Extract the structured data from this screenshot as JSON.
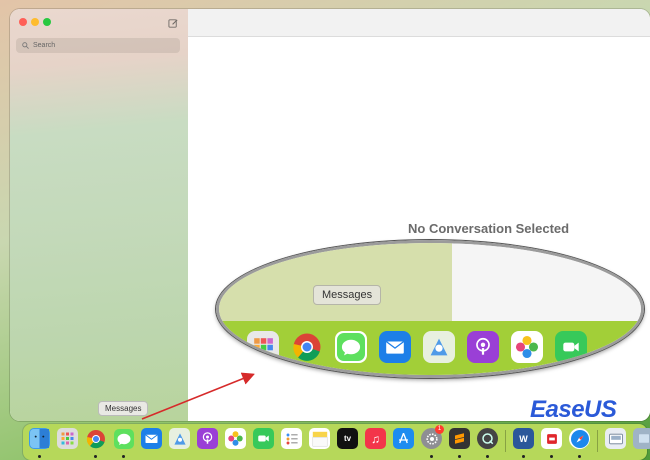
{
  "window": {
    "search": {
      "placeholder": "Search"
    },
    "empty_state": "No Conversation Selected"
  },
  "zoom": {
    "tooltip": "Messages"
  },
  "dock": {
    "tooltip": "Messages",
    "icons": [
      "finder",
      "launchpad",
      "chrome",
      "messages",
      "mail",
      "maps",
      "podcasts",
      "photos",
      "facetime",
      "reminders",
      "notes",
      "apple-tv",
      "music",
      "app-store",
      "system-settings",
      "sublime",
      "quicktime",
      "word",
      "flashcards",
      "safari",
      "preview",
      "downloads"
    ],
    "settings_badge": "1",
    "tv_label": "tv",
    "word_label": "W"
  },
  "watermark": "EaseUS",
  "colors": {
    "red": "#ff5f57",
    "yellow": "#febc2e",
    "green": "#28c840",
    "arrow": "#d62a2a",
    "brand": "#2b5ad8"
  }
}
